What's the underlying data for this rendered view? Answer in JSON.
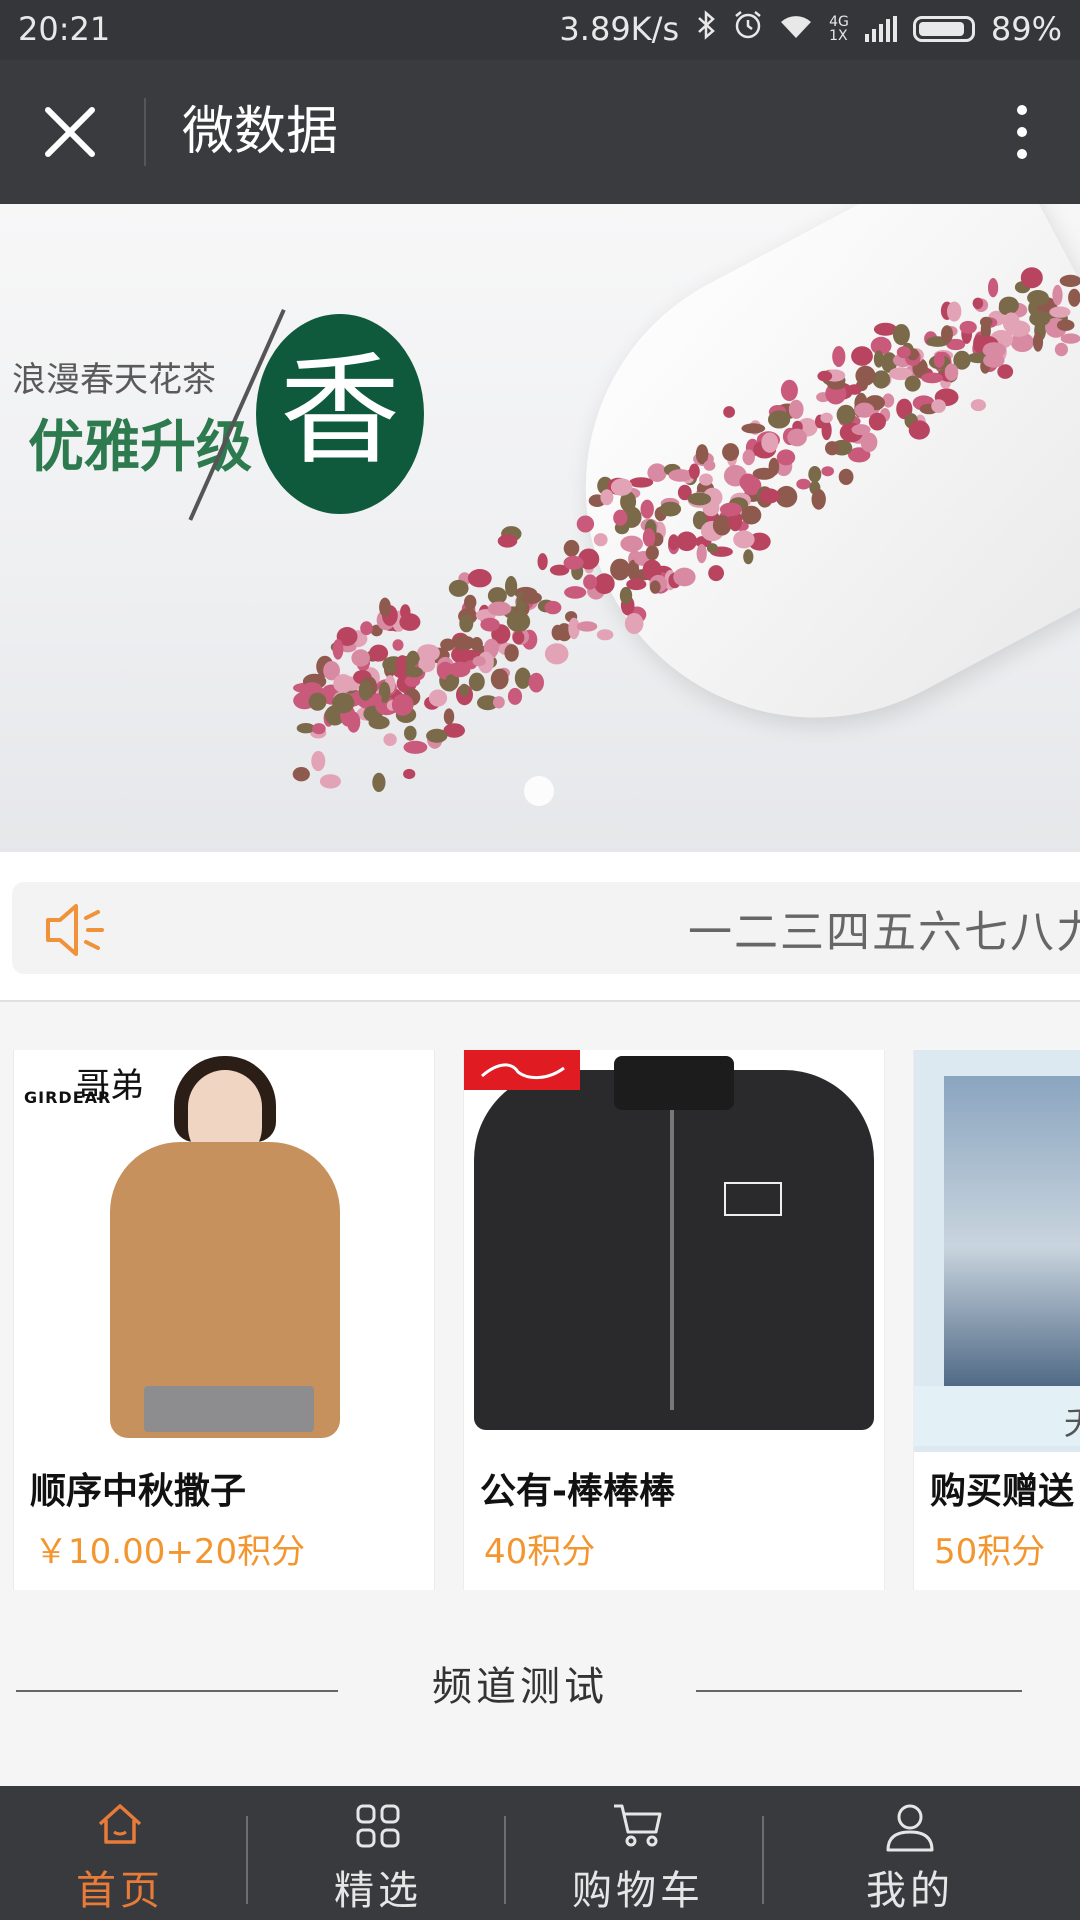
{
  "status_bar": {
    "time": "20:21",
    "network_speed": "3.89K/s",
    "net_type": "4G",
    "net_sub": "1X",
    "battery": "89%",
    "battery_level": 0.89,
    "icons": [
      "bluetooth-icon",
      "alarm-icon",
      "wifi-icon",
      "signal-icon",
      "battery-icon"
    ]
  },
  "nav": {
    "title": "微数据",
    "close_icon": "close-icon",
    "more_icon": "more-vertical-icon"
  },
  "banner": {
    "subtitle": "浪漫春天花茶",
    "headline": "优雅升级",
    "seal_char": "香",
    "slide_count": 1,
    "active_slide": 1
  },
  "notice": {
    "icon": "speaker-icon",
    "text": "一二三四五六七八力"
  },
  "products": [
    {
      "name": "顺序中秋撒子",
      "price": "￥10.00+20积分",
      "logo_text": "GIRDEAR",
      "logo_mark": "哥弟"
    },
    {
      "name": "公有-棒棒棒",
      "price": "40积分"
    },
    {
      "name": "购买赠送",
      "price": "50积分",
      "image_char": "夭"
    }
  ],
  "channel": {
    "title": "频道测试"
  },
  "tabbar": {
    "items": [
      {
        "label": "首页",
        "icon": "home-icon",
        "active": true
      },
      {
        "label": "精选",
        "icon": "grid-icon",
        "active": false
      },
      {
        "label": "购物车",
        "icon": "cart-icon",
        "active": false
      },
      {
        "label": "我的",
        "icon": "user-icon",
        "active": false
      }
    ]
  },
  "colors": {
    "accent": "#e87b38",
    "price": "#f3962f",
    "bar_dark": "#393a3e",
    "seal_green": "#0f5a3c"
  }
}
